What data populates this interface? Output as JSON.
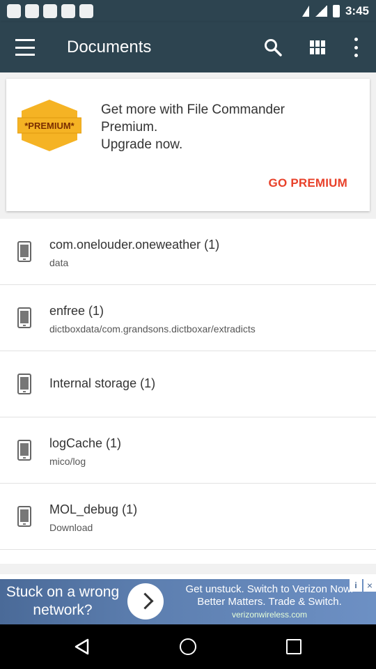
{
  "status_bar": {
    "time": "3:45",
    "icons": [
      "facebook-notification-icon",
      "image-icon",
      "headset-icon",
      "lock-icon",
      "calendar-icon"
    ],
    "right_icons": [
      "wifi-icon",
      "signal-icon",
      "battery-icon"
    ]
  },
  "app_bar": {
    "title": "Documents",
    "icons": [
      "menu-icon",
      "search-icon",
      "grid-view-icon",
      "more-vert-icon"
    ]
  },
  "premium": {
    "badge_text": "*PREMIUM*",
    "message": "Get more with File Commander Premium.\nUpgrade now.",
    "cta_label": "GO PREMIUM",
    "badge_color": "#f5b324",
    "cta_color": "#e8412a"
  },
  "items": [
    {
      "title": "com.onelouder.oneweather (1)",
      "subtitle": "data"
    },
    {
      "title": "enfree (1)",
      "subtitle": "dictboxdata/com.grandsons.dictboxar/extradicts"
    },
    {
      "title": "Internal storage (1)",
      "subtitle": ""
    },
    {
      "title": "logCache (1)",
      "subtitle": "mico/log"
    },
    {
      "title": "MOL_debug (1)",
      "subtitle": "Download"
    }
  ],
  "ad": {
    "left_text": "Stuck on a wrong network?",
    "right_text": "Get unstuck. Switch to Verizon Now. Better Matters. Trade & Switch.",
    "url": "verizonwireless.com",
    "close_label": "×",
    "info_label": "i"
  },
  "nav": {
    "icons": [
      "back-icon",
      "home-icon",
      "recents-icon"
    ]
  },
  "colors": {
    "app_bar": "#2d4450",
    "accent": "#e8412a"
  }
}
